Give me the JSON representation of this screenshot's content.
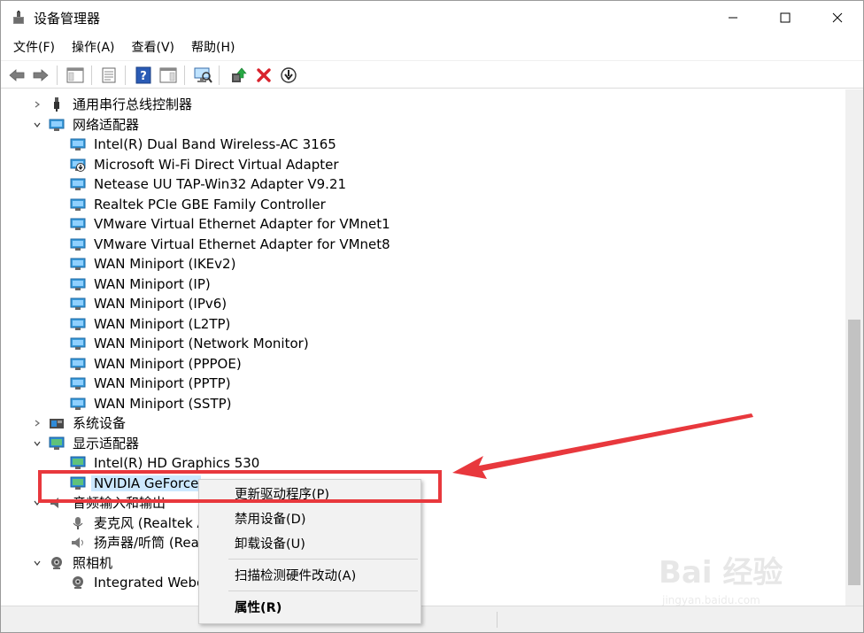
{
  "window": {
    "title": "设备管理器"
  },
  "menubar": [
    {
      "label": "文件(F)"
    },
    {
      "label": "操作(A)"
    },
    {
      "label": "查看(V)"
    },
    {
      "label": "帮助(H)"
    }
  ],
  "tree": {
    "rows": [
      {
        "label": "通用串行总线控制器",
        "level": 0,
        "expander": "collapsed",
        "icon": "usb-icon"
      },
      {
        "label": "网络适配器",
        "level": 0,
        "expander": "expanded",
        "icon": "network-icon"
      },
      {
        "label": "Intel(R) Dual Band Wireless-AC 3165",
        "level": 1,
        "expander": "none",
        "icon": "network-adapter-icon"
      },
      {
        "label": "Microsoft Wi-Fi Direct Virtual Adapter",
        "level": 1,
        "expander": "none",
        "icon": "network-adapter-disabled-icon"
      },
      {
        "label": "Netease UU TAP-Win32 Adapter V9.21",
        "level": 1,
        "expander": "none",
        "icon": "network-adapter-icon"
      },
      {
        "label": "Realtek PCIe GBE Family Controller",
        "level": 1,
        "expander": "none",
        "icon": "network-adapter-icon"
      },
      {
        "label": "VMware Virtual Ethernet Adapter for VMnet1",
        "level": 1,
        "expander": "none",
        "icon": "network-adapter-icon"
      },
      {
        "label": "VMware Virtual Ethernet Adapter for VMnet8",
        "level": 1,
        "expander": "none",
        "icon": "network-adapter-icon"
      },
      {
        "label": "WAN Miniport (IKEv2)",
        "level": 1,
        "expander": "none",
        "icon": "network-adapter-icon"
      },
      {
        "label": "WAN Miniport (IP)",
        "level": 1,
        "expander": "none",
        "icon": "network-adapter-icon"
      },
      {
        "label": "WAN Miniport (IPv6)",
        "level": 1,
        "expander": "none",
        "icon": "network-adapter-icon"
      },
      {
        "label": "WAN Miniport (L2TP)",
        "level": 1,
        "expander": "none",
        "icon": "network-adapter-icon"
      },
      {
        "label": "WAN Miniport (Network Monitor)",
        "level": 1,
        "expander": "none",
        "icon": "network-adapter-icon"
      },
      {
        "label": "WAN Miniport (PPPOE)",
        "level": 1,
        "expander": "none",
        "icon": "network-adapter-icon"
      },
      {
        "label": "WAN Miniport (PPTP)",
        "level": 1,
        "expander": "none",
        "icon": "network-adapter-icon"
      },
      {
        "label": "WAN Miniport (SSTP)",
        "level": 1,
        "expander": "none",
        "icon": "network-adapter-icon"
      },
      {
        "label": "系统设备",
        "level": 0,
        "expander": "collapsed",
        "icon": "system-devices-icon"
      },
      {
        "label": "显示适配器",
        "level": 0,
        "expander": "expanded",
        "icon": "display-adapter-icon"
      },
      {
        "label": "Intel(R) HD Graphics 530",
        "level": 1,
        "expander": "none",
        "icon": "display-adapter-icon"
      },
      {
        "label": "NVIDIA GeForce",
        "level": 1,
        "expander": "none",
        "icon": "display-adapter-icon",
        "selected": true
      },
      {
        "label": "音频输入和输出",
        "level": 0,
        "expander": "expanded",
        "icon": "audio-icon"
      },
      {
        "label": "麦克风 (Realtek A",
        "level": 1,
        "expander": "none",
        "icon": "microphone-icon"
      },
      {
        "label": "扬声器/听筒 (Rea",
        "level": 1,
        "expander": "none",
        "icon": "speaker-icon"
      },
      {
        "label": "照相机",
        "level": 0,
        "expander": "expanded",
        "icon": "camera-icon"
      },
      {
        "label": "Integrated Webca",
        "level": 1,
        "expander": "none",
        "icon": "camera-icon"
      }
    ]
  },
  "context_menu": {
    "items": [
      {
        "label": "更新驱动程序(P)",
        "bold": false
      },
      {
        "label": "禁用设备(D)",
        "bold": false
      },
      {
        "label": "卸载设备(U)",
        "bold": false
      },
      {
        "label": "扫描检测硬件改动(A)",
        "bold": false
      },
      {
        "label": "属性(R)",
        "bold": true
      }
    ]
  },
  "watermark": {
    "text": "Bai 经验",
    "sub": "jingyan.baidu.com"
  },
  "colors": {
    "selection": "#cce8ff",
    "annotation_red": "#e8383d",
    "delete_red": "#d9232d",
    "icon_blue": "#1f7fd6"
  }
}
